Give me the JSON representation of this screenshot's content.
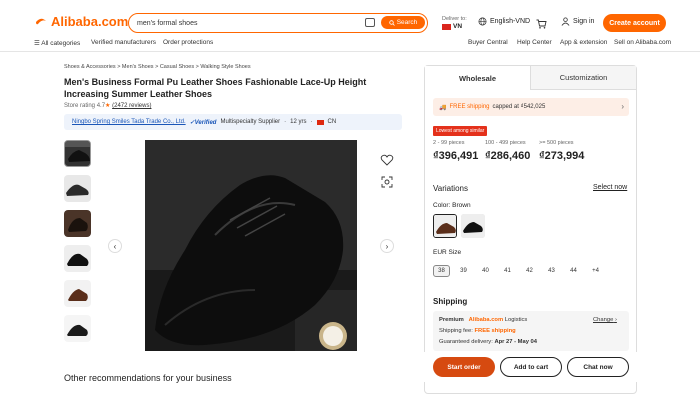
{
  "header": {
    "logo_text": "Alibaba.com",
    "search_value": "men's formal shoes",
    "search_button": "Search",
    "deliver_label": "Deliver to:",
    "deliver_country": "VN",
    "language": "English-VND",
    "signin": "Sign in",
    "create_account": "Create account"
  },
  "subnav": {
    "all_categories": "All categories",
    "verified": "Verified manufacturers",
    "protections": "Order protections",
    "buyer_central": "Buyer Central",
    "help_center": "Help Center",
    "app_extension": "App & extension",
    "sell": "Sell on Alibaba.com"
  },
  "product": {
    "breadcrumb": "Shoes & Accessories  >  Men's Shoes  >  Casual Shoes  >  Walking Style Shoes",
    "title": "Men's Business Formal Pu Leather Shoes Fashionable Lace-Up Height Increasing Summer Leather Shoes",
    "rating_label": "Store rating",
    "rating_value": "4.7",
    "reviews": "(2472 reviews)",
    "supplier_name": "Ningbo Spring Smiles Tada Trade Co., Ltd.",
    "verified": "Verified",
    "supplier_type": "Multispecialty Supplier",
    "years": "12 yrs",
    "country": "CN"
  },
  "recommendations_title": "Other recommendations for your business",
  "panel": {
    "tab_wholesale": "Wholesale",
    "tab_customization": "Customization",
    "free_shipping": "FREE shipping",
    "capped": "capped at ₫542,025",
    "lowest_badge": "Lowest among similar",
    "tiers": [
      {
        "qty": "2 - 99 pieces",
        "price": "₫396,491"
      },
      {
        "qty": "100 - 499 pieces",
        "price": "₫286,460"
      },
      {
        "qty": ">= 500 pieces",
        "price": "₫273,994"
      }
    ],
    "variations": "Variations",
    "select_now": "Select now",
    "color_label": "Color: Brown",
    "size_label": "EUR Size",
    "sizes": [
      "38",
      "39",
      "40",
      "41",
      "42",
      "43",
      "44",
      "+4"
    ],
    "shipping_title": "Shipping",
    "premium": "Premium",
    "ali_logistics": "Alibaba.com",
    "logistics": "Logistics",
    "change": "Change",
    "shipping_fee_label": "Shipping fee:",
    "shipping_fee_value": "FREE shipping",
    "guaranteed_label": "Guaranteed delivery:",
    "guaranteed_value": "Apr 27 - May 04"
  },
  "actions": {
    "start_order": "Start order",
    "add_to_cart": "Add to cart",
    "chat_now": "Chat now"
  },
  "colors": {
    "brand": "#ff6600",
    "start_order": "#d64a10"
  }
}
